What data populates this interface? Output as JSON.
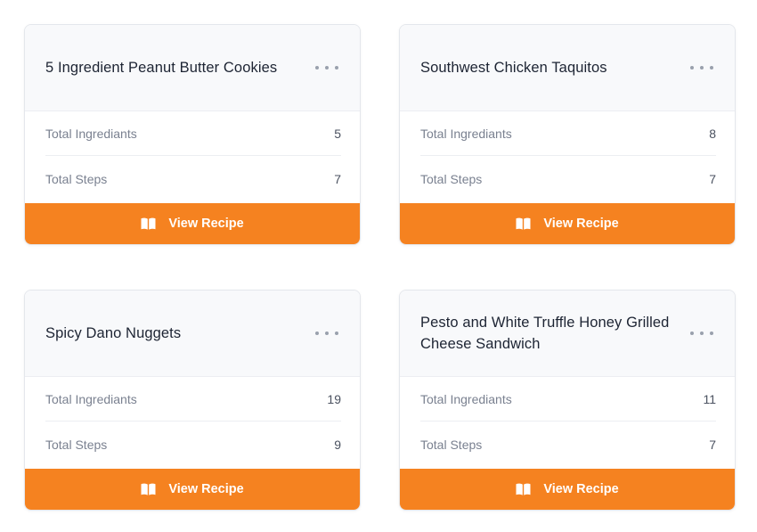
{
  "cards": [
    {
      "title": "5 Ingredient Peanut Butter Cookies",
      "ingredients_label": "Total Ingrediants",
      "ingredients_value": "5",
      "steps_label": "Total Steps",
      "steps_value": "7",
      "button_label": "View Recipe",
      "button_icon": "book-open-icon",
      "menu_icon": "more-horizontal-icon"
    },
    {
      "title": "Southwest Chicken Taquitos",
      "ingredients_label": "Total Ingrediants",
      "ingredients_value": "8",
      "steps_label": "Total Steps",
      "steps_value": "7",
      "button_label": "View Recipe",
      "button_icon": "book-open-icon",
      "menu_icon": "more-horizontal-icon"
    },
    {
      "title": "Spicy Dano Nuggets",
      "ingredients_label": "Total Ingrediants",
      "ingredients_value": "19",
      "steps_label": "Total Steps",
      "steps_value": "9",
      "button_label": "View Recipe",
      "button_icon": "book-open-icon",
      "menu_icon": "more-horizontal-icon"
    },
    {
      "title": "Pesto and White Truffle Honey Grilled Cheese Sandwich",
      "ingredients_label": "Total Ingrediants",
      "ingredients_value": "11",
      "steps_label": "Total Steps",
      "steps_value": "7",
      "button_label": "View Recipe",
      "button_icon": "book-open-icon",
      "menu_icon": "more-horizontal-icon"
    }
  ],
  "colors": {
    "accent": "#f58220",
    "header_bg": "#f8f9fb",
    "border": "#e4e7ec",
    "title_text": "#1d2433",
    "muted_text": "#7a8190"
  }
}
